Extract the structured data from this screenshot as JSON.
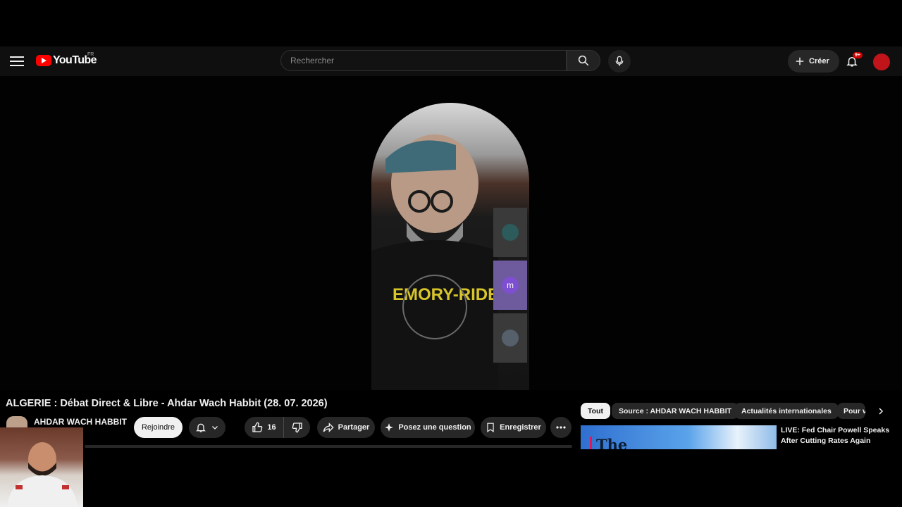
{
  "header": {
    "logo_text": "YouTube",
    "region": "FR",
    "search_placeholder": "Rechercher",
    "create_label": "Créer",
    "notif_badge": "9+"
  },
  "player": {
    "participant_initial": "m"
  },
  "video": {
    "title": "ALGERIE : Débat Direct & Libre - Ahdar Wach Habbit (28. 07. 2026)",
    "channel": "AHDAR WACH HABBIT",
    "join_label": "Rejoindre",
    "likes": "16",
    "share_label": "Partager",
    "ask_label": "Posez une question",
    "save_label": "Enregistrer"
  },
  "chips": [
    "Tout",
    "Source : AHDAR WACH HABBIT",
    "Actualités internationales",
    "Pour v"
  ],
  "recommendation": {
    "thumb_text": "The",
    "title": "LIVE: Fed Chair Powell Speaks After Cutting Rates Again"
  },
  "colors": {
    "accent_red": "#ff0000",
    "background": "#0f0f0f",
    "pill": "#272727"
  }
}
